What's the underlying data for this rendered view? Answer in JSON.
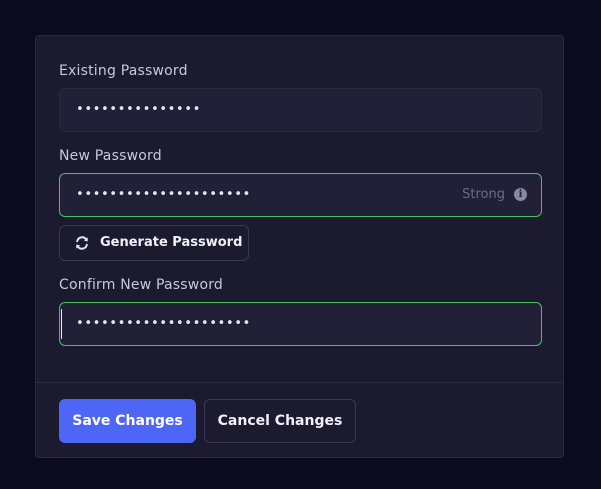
{
  "form": {
    "existing": {
      "label": "Existing Password",
      "value": "•••••••••••••••"
    },
    "new": {
      "label": "New Password",
      "value": "•••••••••••••••••••••",
      "strength": "Strong"
    },
    "generate_label": "Generate Password",
    "confirm": {
      "label": "Confirm New Password",
      "value": "•••••••••••••••••••••"
    }
  },
  "actions": {
    "save_label": "Save Changes",
    "cancel_label": "Cancel Changes"
  },
  "colors": {
    "accent": "#4d66f5",
    "valid_border": "#45c45a",
    "background": "#0b0a1f",
    "card": "#1b1a2f"
  },
  "icons": {
    "generate": "refresh-icon",
    "strength_info": "info-icon"
  }
}
